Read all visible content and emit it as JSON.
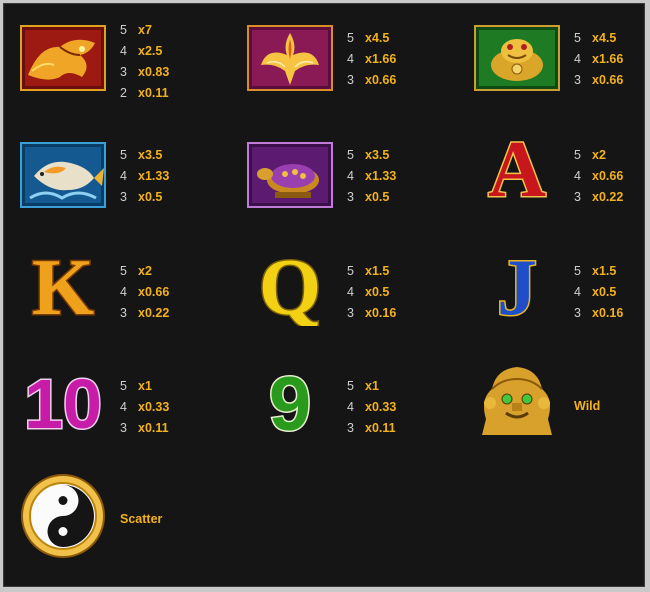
{
  "colors": {
    "background": "#151515",
    "count": "#cfcfcf",
    "multiplier": "#f3b21c",
    "label": "#f3b21c"
  },
  "paytable": [
    {
      "symbol": "dragon-icon",
      "pays": [
        {
          "count": "5",
          "mult": "x7"
        },
        {
          "count": "4",
          "mult": "x2.5"
        },
        {
          "count": "3",
          "mult": "x0.83"
        },
        {
          "count": "2",
          "mult": "x0.11"
        }
      ]
    },
    {
      "symbol": "phoenix-icon",
      "pays": [
        {
          "count": "5",
          "mult": "x4.5"
        },
        {
          "count": "4",
          "mult": "x1.66"
        },
        {
          "count": "3",
          "mult": "x0.66"
        }
      ]
    },
    {
      "symbol": "golden-toad-icon",
      "pays": [
        {
          "count": "5",
          "mult": "x4.5"
        },
        {
          "count": "4",
          "mult": "x1.66"
        },
        {
          "count": "3",
          "mult": "x0.66"
        }
      ]
    },
    {
      "symbol": "koi-fish-icon",
      "pays": [
        {
          "count": "5",
          "mult": "x3.5"
        },
        {
          "count": "4",
          "mult": "x1.33"
        },
        {
          "count": "3",
          "mult": "x0.5"
        }
      ]
    },
    {
      "symbol": "turtle-icon",
      "pays": [
        {
          "count": "5",
          "mult": "x3.5"
        },
        {
          "count": "4",
          "mult": "x1.33"
        },
        {
          "count": "3",
          "mult": "x0.5"
        }
      ]
    },
    {
      "symbol": "ace-icon",
      "glyph": "A",
      "pays": [
        {
          "count": "5",
          "mult": "x2"
        },
        {
          "count": "4",
          "mult": "x0.66"
        },
        {
          "count": "3",
          "mult": "x0.22"
        }
      ]
    },
    {
      "symbol": "king-icon",
      "glyph": "K",
      "pays": [
        {
          "count": "5",
          "mult": "x2"
        },
        {
          "count": "4",
          "mult": "x0.66"
        },
        {
          "count": "3",
          "mult": "x0.22"
        }
      ]
    },
    {
      "symbol": "queen-icon",
      "glyph": "Q",
      "pays": [
        {
          "count": "5",
          "mult": "x1.5"
        },
        {
          "count": "4",
          "mult": "x0.5"
        },
        {
          "count": "3",
          "mult": "x0.16"
        }
      ]
    },
    {
      "symbol": "jack-icon",
      "glyph": "J",
      "pays": [
        {
          "count": "5",
          "mult": "x1.5"
        },
        {
          "count": "4",
          "mult": "x0.5"
        },
        {
          "count": "3",
          "mult": "x0.16"
        }
      ]
    },
    {
      "symbol": "ten-icon",
      "glyph": "10",
      "pays": [
        {
          "count": "5",
          "mult": "x1"
        },
        {
          "count": "4",
          "mult": "x0.33"
        },
        {
          "count": "3",
          "mult": "x0.11"
        }
      ]
    },
    {
      "symbol": "nine-icon",
      "glyph": "9",
      "pays": [
        {
          "count": "5",
          "mult": "x1"
        },
        {
          "count": "4",
          "mult": "x0.33"
        },
        {
          "count": "3",
          "mult": "x0.11"
        }
      ]
    },
    {
      "symbol": "foo-dog-wild-icon",
      "label": "Wild"
    },
    {
      "symbol": "yin-yang-scatter-icon",
      "label": "Scatter"
    }
  ]
}
